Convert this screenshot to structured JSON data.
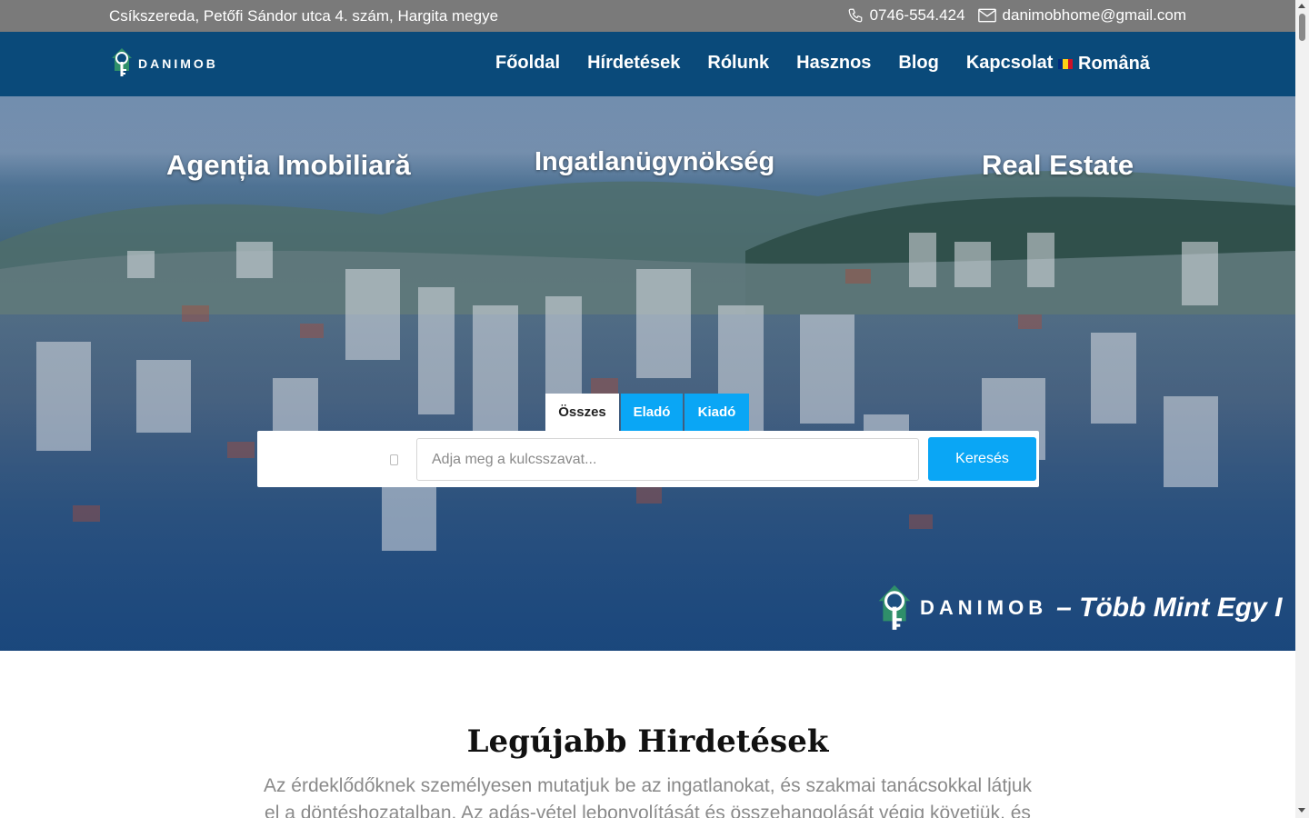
{
  "topbar": {
    "address": "Csíkszereda, Petőfi Sándor utca 4. szám, Hargita megye",
    "phone": "0746-554.424",
    "email": "danimobhome@gmail.com",
    "phone_icon": "phone-icon",
    "email_icon": "mail-icon"
  },
  "nav": {
    "logo_text": "DANIMOB",
    "items": [
      "Főoldal",
      "Hírdetések",
      "Rólunk",
      "Hasznos",
      "Blog",
      "Kapcsolat"
    ],
    "language": "Română",
    "language_flag_colors": [
      "#002b7f",
      "#fcd116",
      "#ce1126"
    ]
  },
  "hero": {
    "titles": [
      "Agenția Imobiliară",
      "Ingatlanügynökség",
      "Real Estate"
    ],
    "search": {
      "tabs": [
        "Összes",
        "Eladó",
        "Kiadó"
      ],
      "active_tab": "Összes",
      "keyword_placeholder": "Adja meg a kulcsszavat...",
      "button_label": "Keresés"
    },
    "marquee": {
      "logo_text": "DANIMOB",
      "slogan": "– Több Mint Egy I"
    }
  },
  "listings": {
    "title": "Legújabb Hirdetések",
    "description": "Az érdeklődőknek személyesen mutatjuk be az ingatlanokat, és szakmai tanácsokkal látjuk el a döntéshozatalban. Az adás-vétel lebonvolítását és összehangolását végig követiük. és"
  },
  "colors": {
    "topbar": "#7a7a7a",
    "navbar": "#0a4a7a",
    "accent": "#0aa6f5"
  }
}
